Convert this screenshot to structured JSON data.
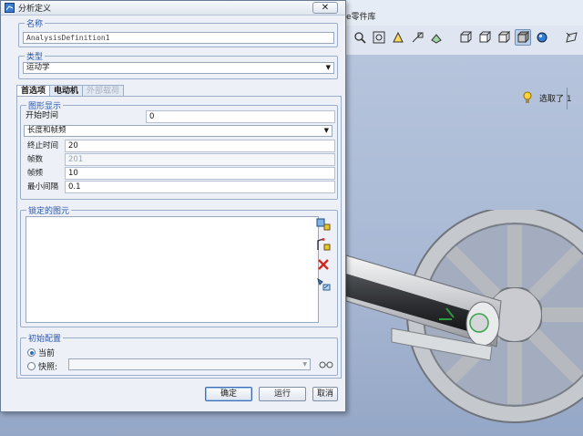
{
  "app": {
    "title_fragment": "e零件库",
    "status_text": "选取了 1"
  },
  "toolbar": {
    "icons": [
      "zoom-in-icon",
      "zoom-fit-icon",
      "pan-icon",
      "view-orient-icon",
      "saved-views-icon",
      "wireframe-icon",
      "hidden-line-icon",
      "no-hidden-icon",
      "shading-icon",
      "appearance-icon",
      "datum-plane-icon"
    ]
  },
  "dialog": {
    "title": "分析定义",
    "close_label": "✕",
    "name_group": {
      "label": "名称",
      "value": "AnalysisDefinition1"
    },
    "type_group": {
      "label": "类型",
      "selected": "运动学"
    },
    "tabs": [
      {
        "label": "首选项",
        "state": "selected"
      },
      {
        "label": "电动机",
        "state": "normal"
      },
      {
        "label": "外部载荷",
        "state": "disabled"
      }
    ],
    "graph_group": {
      "label": "图形显示",
      "start_time_label": "开始时间",
      "start_time_value": "0",
      "mode_selected": "长度和帧频",
      "rows": [
        {
          "label": "终止时间",
          "value": "20",
          "disabled": false
        },
        {
          "label": "帧数",
          "value": "201",
          "disabled": true
        },
        {
          "label": "帧频",
          "value": "10",
          "disabled": false
        },
        {
          "label": "最小间隔",
          "value": "0.1",
          "disabled": false
        }
      ]
    },
    "locked_group": {
      "label": "锁定的图元"
    },
    "init_group": {
      "label": "初始配置",
      "options": [
        {
          "label": "当前",
          "selected": true
        },
        {
          "label": "快照:",
          "selected": false
        }
      ]
    },
    "buttons": {
      "ok": "确定",
      "run": "运行",
      "cancel": "取消"
    }
  },
  "colors": {
    "group_label": "#2a55a8",
    "viewport_top": "#b6c4dc",
    "viewport_bottom": "#95a7c6"
  }
}
